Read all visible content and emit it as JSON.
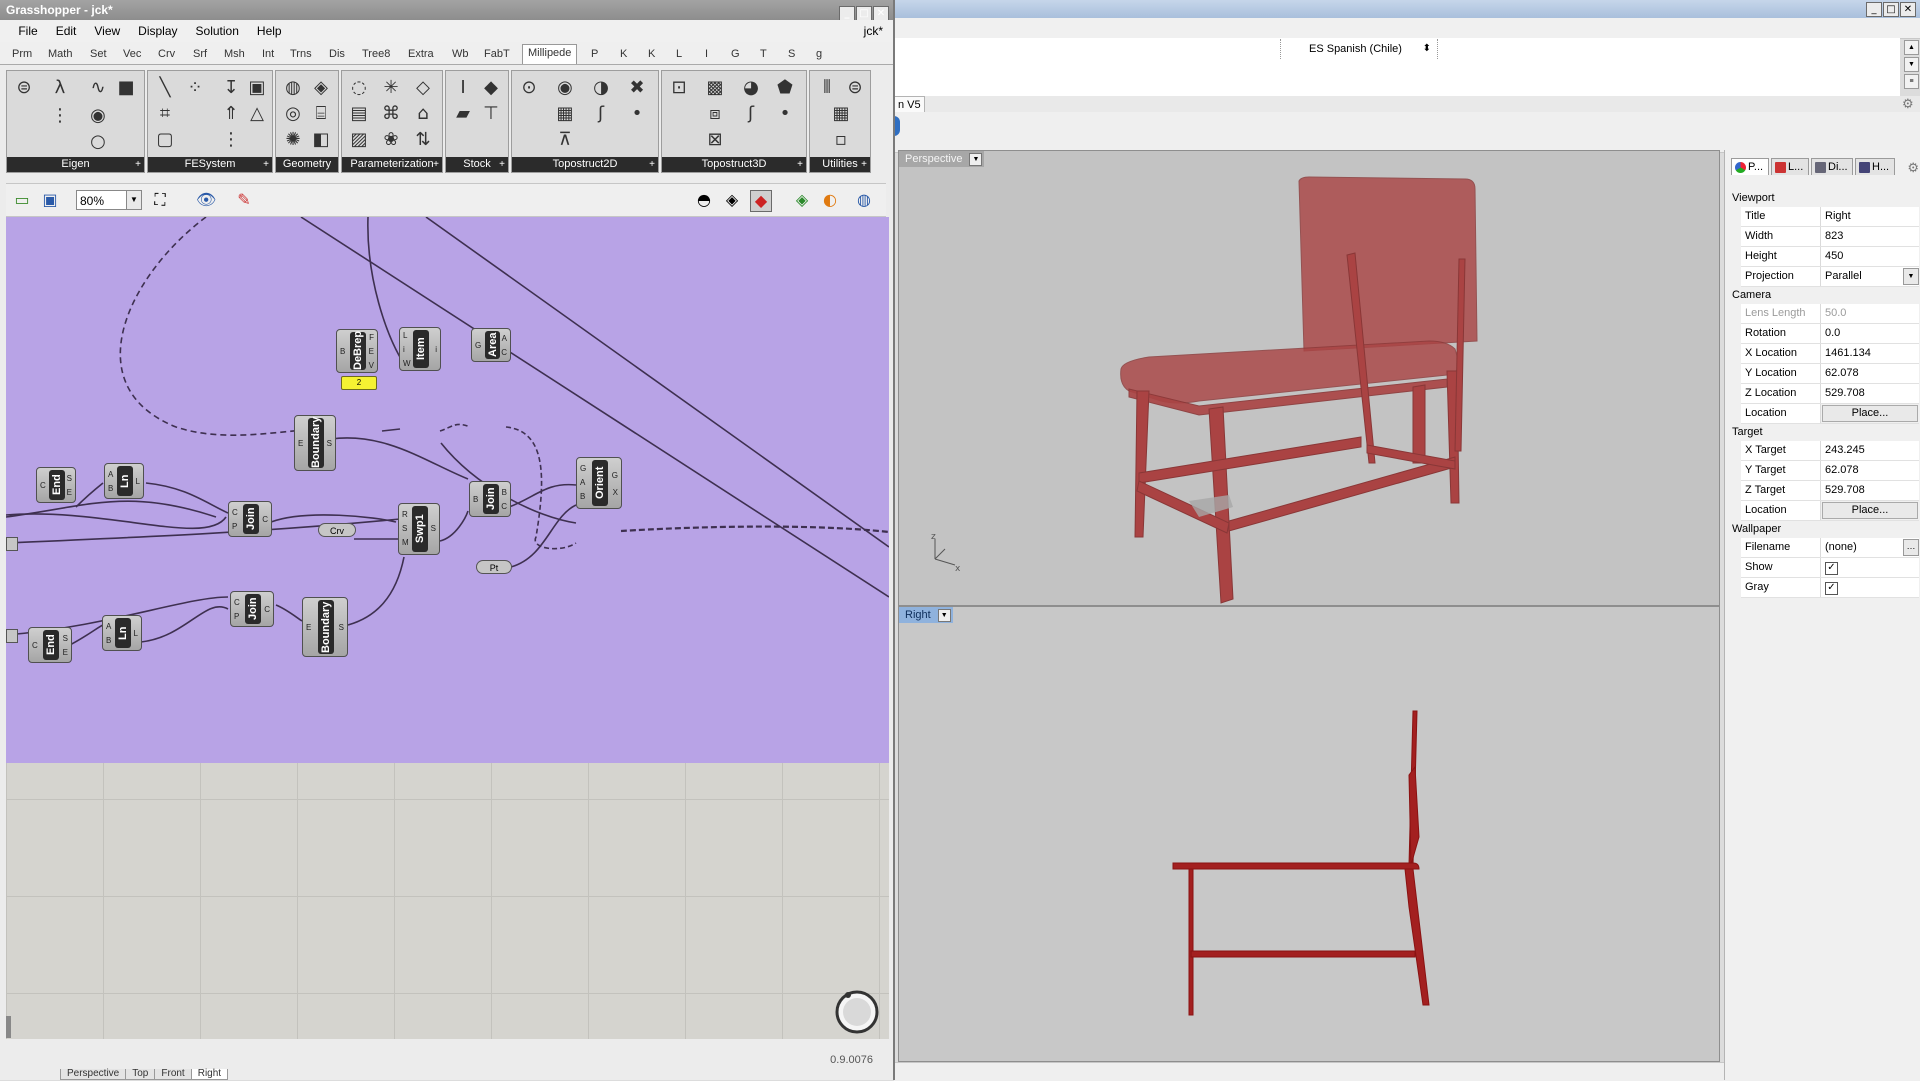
{
  "rhino": {
    "command": {
      "language": "ES Spanish (Chile)"
    },
    "tab_label": "n V5",
    "viewports": {
      "perspective": {
        "label": "Perspective"
      },
      "right": {
        "label": "Right"
      }
    },
    "bottom_tabs": [
      "Perspective",
      "Top",
      "Front",
      "Right"
    ]
  },
  "properties": {
    "tabs": [
      "P...",
      "L...",
      "Di...",
      "H..."
    ],
    "sections": {
      "viewport": {
        "title": "Viewport",
        "rows": [
          {
            "label": "Title",
            "value": "Right"
          },
          {
            "label": "Width",
            "value": "823"
          },
          {
            "label": "Height",
            "value": "450"
          },
          {
            "label": "Projection",
            "value": "Parallel"
          }
        ]
      },
      "camera": {
        "title": "Camera",
        "rows": [
          {
            "label": "Lens Length",
            "value": "50.0"
          },
          {
            "label": "Rotation",
            "value": "0.0"
          },
          {
            "label": "X Location",
            "value": "1461.134"
          },
          {
            "label": "Y Location",
            "value": "62.078"
          },
          {
            "label": "Z Location",
            "value": "529.708"
          },
          {
            "label": "Location",
            "value": "Place..."
          }
        ]
      },
      "target": {
        "title": "Target",
        "rows": [
          {
            "label": "X Target",
            "value": "243.245"
          },
          {
            "label": "Y Target",
            "value": "62.078"
          },
          {
            "label": "Z Target",
            "value": "529.708"
          },
          {
            "label": "Location",
            "value": "Place..."
          }
        ]
      },
      "wallpaper": {
        "title": "Wallpaper",
        "rows": [
          {
            "label": "Filename",
            "value": "(none)"
          },
          {
            "label": "Show",
            "value": true
          },
          {
            "label": "Gray",
            "value": true
          }
        ]
      }
    }
  },
  "grasshopper": {
    "title": "Grasshopper - jck*",
    "doc_name": "jck*",
    "menu": [
      "File",
      "Edit",
      "View",
      "Display",
      "Solution",
      "Help"
    ],
    "tabs": [
      "Prm",
      "Math",
      "Set",
      "Vec",
      "Crv",
      "Srf",
      "Msh",
      "Int",
      "Trns",
      "Dis",
      "Tree8",
      "Extra",
      "Wb",
      "FabT",
      "Millipede",
      "P",
      "K",
      "K",
      "L",
      "I",
      "G",
      "T",
      "S",
      "g"
    ],
    "active_tab": "Millipede",
    "groups": [
      "Eigen",
      "FESystem",
      "Geometry",
      "Parameterization",
      "Stock",
      "Topostruct2D",
      "Topostruct3D",
      "Utilities"
    ],
    "zoom": "80%",
    "version": "0.9.0076",
    "nodes": {
      "debrep": {
        "name": "DeBrep",
        "in": [
          "B"
        ],
        "out": [
          "F",
          "E",
          "V"
        ]
      },
      "item": {
        "name": "Item",
        "in": [
          "L",
          "i",
          "W"
        ],
        "out": [
          "i"
        ]
      },
      "area": {
        "name": "Area",
        "in": [
          "G"
        ],
        "out": [
          "A",
          "C"
        ]
      },
      "slider_value": "2",
      "boundary1": {
        "name": "Boundary",
        "in": [
          "E"
        ],
        "out": [
          "S"
        ]
      },
      "end1": {
        "name": "End",
        "in": [
          "C"
        ],
        "out": [
          "S",
          "E"
        ]
      },
      "ln1": {
        "name": "Ln",
        "in": [
          "A",
          "B"
        ],
        "out": [
          "L"
        ]
      },
      "join1": {
        "name": "Join",
        "in": [
          "C",
          "P"
        ],
        "out": [
          "C"
        ]
      },
      "crv": "Crv",
      "swp1": {
        "name": "Swp1",
        "in": [
          "R",
          "S",
          "M"
        ],
        "out": [
          "S"
        ]
      },
      "join2": {
        "name": "Join",
        "in": [
          "B"
        ],
        "out": [
          "B",
          "C"
        ]
      },
      "pt": "Pt",
      "orient": {
        "name": "Orient",
        "in": [
          "G",
          "A",
          "B"
        ],
        "out": [
          "G",
          "X"
        ]
      },
      "join3": {
        "name": "Join",
        "in": [
          "C",
          "P"
        ],
        "out": [
          "C"
        ]
      },
      "boundary2": {
        "name": "Boundary",
        "in": [
          "E"
        ],
        "out": [
          "S"
        ]
      },
      "end2": {
        "name": "End",
        "in": [
          "C"
        ],
        "out": [
          "S",
          "E"
        ]
      },
      "ln2": {
        "name": "Ln",
        "in": [
          "A",
          "B"
        ],
        "out": [
          "L"
        ]
      }
    }
  },
  "colors": {
    "group_fill": "#b8a3e6",
    "chair": "#a32020",
    "wire": "#3e3050",
    "slider": "#f5f232"
  }
}
